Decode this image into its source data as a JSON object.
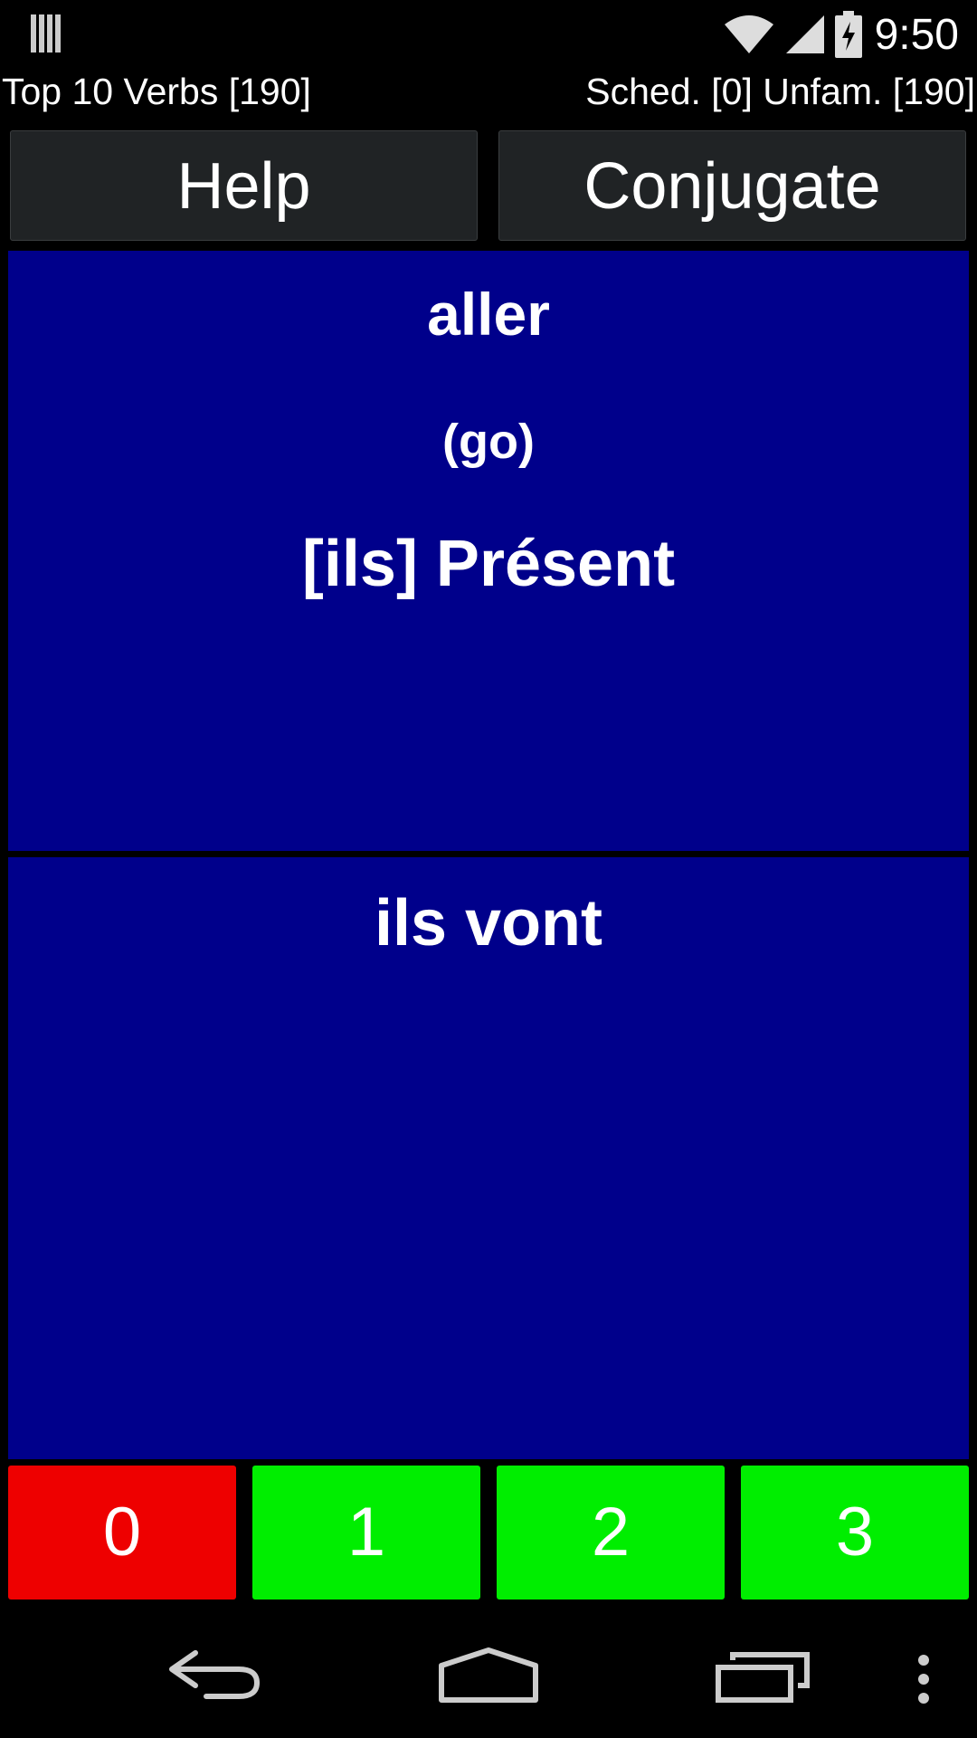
{
  "status_bar": {
    "time": "9:50",
    "icons": [
      "notification-bars-icon",
      "wifi-icon",
      "signal-icon",
      "battery-charging-icon"
    ]
  },
  "info": {
    "deck": "Top 10 Verbs [190]",
    "stats": "Sched. [0] Unfam. [190]"
  },
  "buttons": {
    "help": "Help",
    "conjugate": "Conjugate"
  },
  "question": {
    "verb": "aller",
    "translation": "(go)",
    "tense": "[ils] Présent"
  },
  "answer": {
    "text": "ils vont"
  },
  "grades": [
    {
      "label": "0",
      "color": "#ee0000"
    },
    {
      "label": "1",
      "color": "#00ee00"
    },
    {
      "label": "2",
      "color": "#00ee00"
    },
    {
      "label": "3",
      "color": "#00ee00"
    }
  ],
  "colors": {
    "panel_background": "#00008b",
    "button_background": "#202325"
  },
  "nav": {
    "icons": [
      "back-icon",
      "home-icon",
      "recent-apps-icon",
      "menu-icon"
    ]
  }
}
